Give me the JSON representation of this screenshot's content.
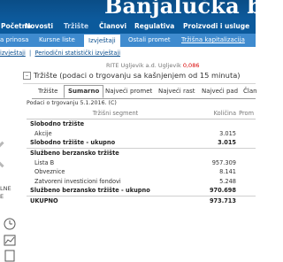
{
  "header": {
    "title": "Banjalučka berza"
  },
  "main_nav": [
    {
      "label": "Početna"
    },
    {
      "label": "Novosti"
    },
    {
      "label": "Tržište"
    },
    {
      "label": "Članovi"
    },
    {
      "label": "Regulativa"
    },
    {
      "label": "Proizvodi i usluge"
    }
  ],
  "sub_nav": [
    {
      "label": "a prinosa"
    },
    {
      "label": "Kursne liste"
    },
    {
      "label": "Izvještaji"
    },
    {
      "label": "Ostali promet"
    },
    {
      "label": "Tržišna kapitalizacija"
    }
  ],
  "third_nav": {
    "item1": "izvještaji",
    "item2": "Periodični statistički izvještaji"
  },
  "ticker": {
    "text": "RITE Ugljevik a.d. Ugljevik",
    "value": "0,086"
  },
  "left_panel": {
    "line1": "LNE",
    "line2": "E"
  },
  "panel": {
    "title": "Tržište (podaci o trgovanju sa kašnjenjem od 15 minuta)",
    "tabs": [
      "Tržište",
      "Sumarno",
      "Najveći promet",
      "Najveći rast",
      "Najveći pad",
      "Član"
    ],
    "selected_tab": "Sumarno",
    "date_note": "Podaci o trgovanju 5.1.2016. (C)"
  },
  "table": {
    "headers": [
      "Tržišni segment",
      "Količina",
      "Prom"
    ],
    "rows": [
      {
        "label": "Slobodno tržište",
        "qty": "",
        "type": "group"
      },
      {
        "label": "Akcije",
        "qty": "3.015",
        "type": "sub"
      },
      {
        "label": "Slobodno tržište - ukupno",
        "qty": "3.015",
        "type": "total"
      },
      {
        "label": "Službeno berzansko tržište",
        "qty": "",
        "type": "group"
      },
      {
        "label": "Lista B",
        "qty": "957.309",
        "type": "sub"
      },
      {
        "label": "Obveznice",
        "qty": "8.141",
        "type": "sub"
      },
      {
        "label": "Zatvoreni investicioni fondovi",
        "qty": "5.248",
        "type": "sub"
      },
      {
        "label": "Službeno berzansko tržište - ukupno",
        "qty": "970.698",
        "type": "total"
      },
      {
        "label": "UKUPNO",
        "qty": "973.713",
        "type": "total"
      }
    ]
  },
  "colors": {
    "nav_dark": "#0b5a9c",
    "nav_light": "#3f8bcf",
    "ticker_red": "#d80000"
  }
}
